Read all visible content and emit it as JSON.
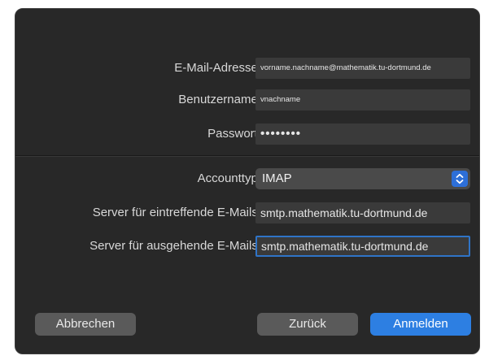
{
  "form": {
    "email_label": "E-Mail-Adresse:",
    "email_value": "vorname.nachname@mathematik.tu-dortmund.de",
    "username_label": "Benutzername:",
    "username_value": "vnachname",
    "password_label": "Passwort:",
    "password_value": "••••••••",
    "account_type_label": "Accounttyp:",
    "account_type_value": "IMAP",
    "incoming_label": "Server für eintreffende E-Mails:",
    "incoming_value": "smtp.mathematik.tu-dortmund.de",
    "outgoing_label": "Server für ausgehende E-Mails:",
    "outgoing_value": "smtp.mathematik.tu-dortmund.de"
  },
  "buttons": {
    "cancel": "Abbrechen",
    "back": "Zurück",
    "signin": "Anmelden"
  },
  "icons": {
    "account_type_stepper": "chevron-up-down-icon"
  },
  "colors": {
    "accent": "#2d7fe2",
    "dialog_bg": "#282828",
    "field_bg": "#3a3a3a",
    "focus_ring": "#2f74c7"
  }
}
